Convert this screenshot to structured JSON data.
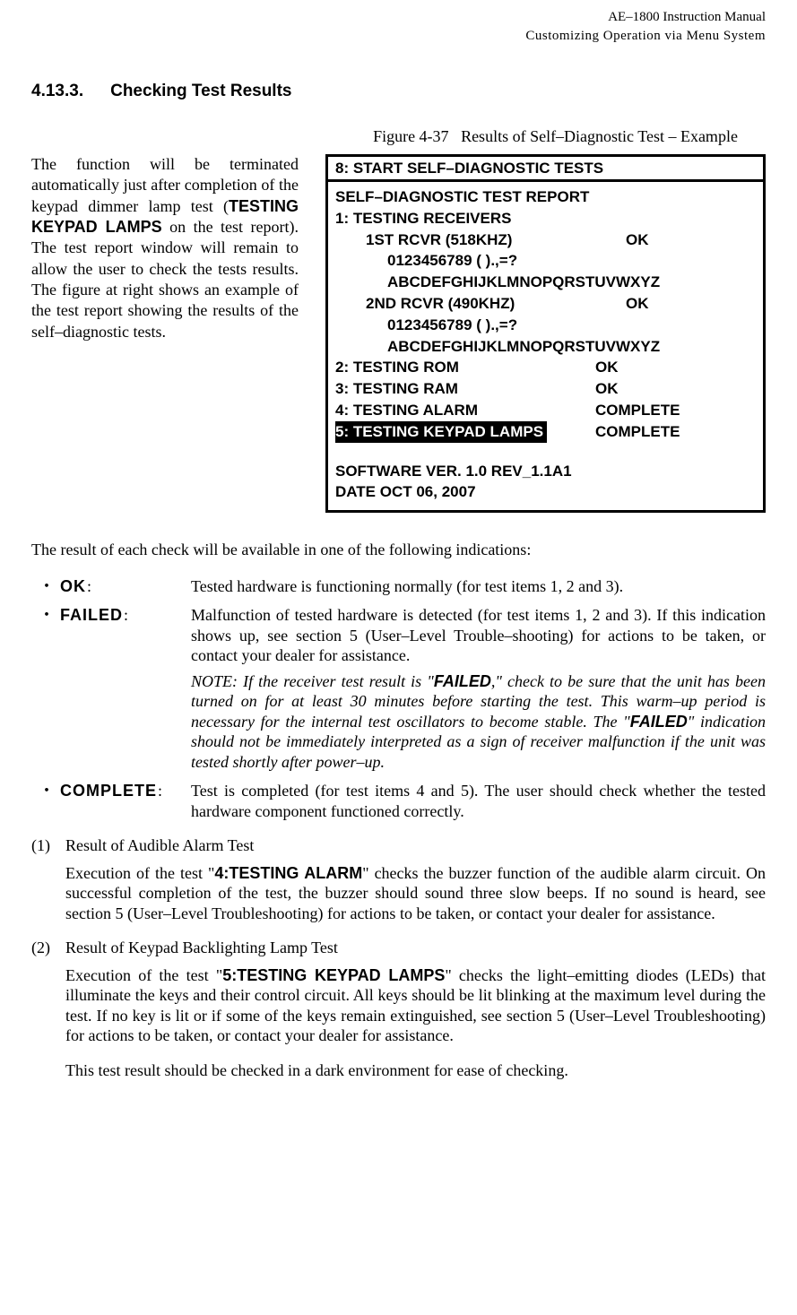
{
  "header": {
    "line1": "AE–1800 Instruction Manual",
    "line2": "Customizing Operation via Menu System"
  },
  "section": {
    "number": "4.13.3.",
    "title": "Checking Test Results"
  },
  "figure": {
    "label": "Figure 4-37",
    "title": "Results of Self–Diagnostic Test – Example"
  },
  "left_para": {
    "pre": "The function will be terminated automatically just after completion of the keypad dimmer lamp test (",
    "bold": "TESTING KEYPAD LAMPS",
    "post": " on the test report). The test report window will remain to allow the user to check the tests results. The figure at right shows an example of the test report showing the results of the self–diagnostic tests."
  },
  "panel": {
    "title": "8: START SELF–DIAGNOSTIC TESTS",
    "report_heading": "SELF–DIAGNOSTIC TEST REPORT",
    "rows": {
      "t1_label": "1: TESTING RECEIVERS",
      "r1_label": "1ST RCVR (518KHZ)",
      "r1_status": "OK",
      "r1_chars1": "0123456789 ( ).,=?",
      "r1_chars2": "ABCDEFGHIJKLMNOPQRSTUVWXYZ",
      "r2_label": "2ND RCVR (490KHZ)",
      "r2_status": "OK",
      "r2_chars1": "0123456789 ( ).,=?",
      "r2_chars2": "ABCDEFGHIJKLMNOPQRSTUVWXYZ",
      "t2_label": "2:  TESTING ROM",
      "t2_status": "OK",
      "t3_label": "3: TESTING RAM",
      "t3_status": "OK",
      "t4_label": "4: TESTING ALARM",
      "t4_status": "COMPLETE",
      "t5_label": "5: TESTING KEYPAD LAMPS",
      "t5_status": "COMPLETE",
      "sw": "SOFTWARE VER. 1.0     REV_1.1A1",
      "date": "DATE OCT 06, 2007"
    }
  },
  "intro": "The result of each check will be available in one of the following indications:",
  "defs": {
    "ok": {
      "term": "OK",
      "desc": "Tested hardware is functioning normally (for test items 1, 2 and 3)."
    },
    "failed": {
      "term": "FAILED",
      "desc": "Malfunction of tested hardware is detected (for test items 1, 2 and 3). If this indication shows up, see section 5 (User–Level Trouble–shooting) for actions to be taken, or contact your dealer for assistance.",
      "note_pre": "NOTE: If the receiver test result is \"",
      "note_b1": "FAILED",
      "note_mid": ",\" check to be sure that the unit has been turned on for at least 30 minutes before starting the test. This warm–up period is necessary for the internal test oscillators to become stable. The \"",
      "note_b2": "FAILED",
      "note_post": "\" indication should not be immediately interpreted as a sign of receiver malfunction if the unit was tested shortly after power–up."
    },
    "complete": {
      "term": "COMPLETE",
      "desc": "Test is completed (for test items 4 and 5). The user should check whether the tested hardware component functioned correctly."
    }
  },
  "sub1": {
    "n": "(1)",
    "title": "Result of Audible Alarm Test",
    "body_pre": "Execution of the test \"",
    "body_b": "4:TESTING ALARM",
    "body_post": "\" checks the buzzer function of the audible alarm circuit. On successful completion of the test, the buzzer should sound three slow beeps. If no sound is heard, see section 5 (User–Level Troubleshooting) for actions to be taken, or contact your dealer for assistance."
  },
  "sub2": {
    "n": "(2)",
    "title": "Result of Keypad Backlighting Lamp Test",
    "body_pre": "Execution of the test \"",
    "body_b": "5:TESTING KEYPAD LAMPS",
    "body_post": "\" checks the light–emitting diodes (LEDs) that illuminate the keys and their control circuit. All keys should be lit blinking at the maximum level during the test. If no key is lit or if some of the keys remain extinguished, see section 5 (User–Level Troubleshooting) for actions to be taken, or contact your dealer for assistance.",
    "body2": "This test result should be checked in a dark environment for ease of checking."
  }
}
